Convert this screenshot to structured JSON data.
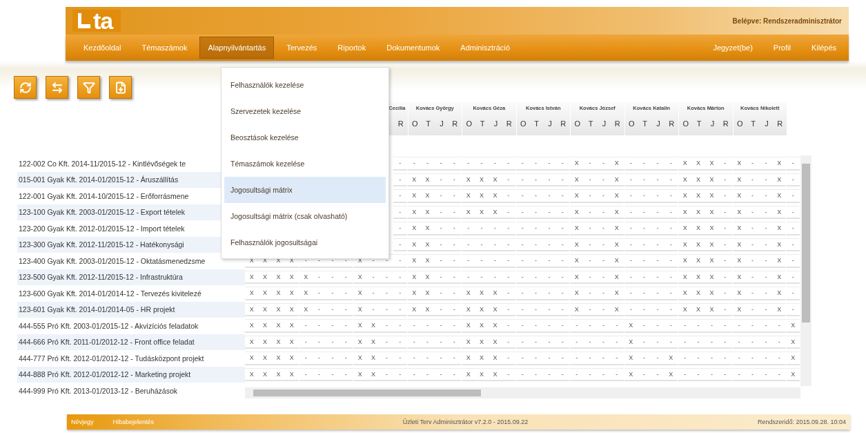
{
  "header": {
    "logo": "ta",
    "login": "Belépve: Rendszeradminisztrátor"
  },
  "nav": {
    "items": [
      {
        "label": "Kezdőoldal",
        "selected": false
      },
      {
        "label": "Témaszámok",
        "selected": false
      },
      {
        "label": "Alapnyilvántartás",
        "selected": true
      },
      {
        "label": "Tervezés",
        "selected": false
      },
      {
        "label": "Riportok",
        "selected": false
      },
      {
        "label": "Dokumentumok",
        "selected": false
      },
      {
        "label": "Adminisztráció",
        "selected": false
      }
    ],
    "right_items": [
      "Jegyzet(be)",
      "Profil",
      "Kilépés"
    ]
  },
  "toolbar": [
    {
      "kind": "refresh"
    },
    {
      "kind": "columns"
    },
    {
      "kind": "filter"
    },
    {
      "kind": "export"
    }
  ],
  "dropdown": [
    {
      "label": "Felhasználók kezelése",
      "selected": false
    },
    {
      "label": "Szervezetek kezelése",
      "selected": false
    },
    {
      "label": "Beosztások kezelése",
      "selected": false
    },
    {
      "label": "Témaszámok kezelése",
      "selected": false
    },
    {
      "label": "Jogosultsági mátrix",
      "selected": true
    },
    {
      "label": "Jogosultsági mátrix (csak olvasható)",
      "selected": false
    },
    {
      "label": "Felhasználók jogosultságai",
      "selected": false
    }
  ],
  "matrix": {
    "people": [
      {
        "name": "Cecília",
        "letters": [
          "R"
        ]
      },
      {
        "name": "Kovács György",
        "letters": [
          "O",
          "T",
          "J",
          "R"
        ]
      },
      {
        "name": "Kovács Géza",
        "letters": [
          "O",
          "T",
          "J",
          "R"
        ]
      },
      {
        "name": "Kovács István",
        "letters": [
          "O",
          "T",
          "J",
          "R"
        ]
      },
      {
        "name": "Kovács József",
        "letters": [
          "O",
          "T",
          "J",
          "R"
        ]
      },
      {
        "name": "Kovács Katalin",
        "letters": [
          "O",
          "T",
          "J",
          "R"
        ]
      },
      {
        "name": "Kovács Márton",
        "letters": [
          "O",
          "T",
          "J",
          "R"
        ]
      },
      {
        "name": "Kovács Nikolett",
        "letters": [
          "O",
          "T",
          "J",
          "R"
        ]
      }
    ],
    "rows": [
      {
        "label": "122-002 Co Kft. 2014-11/2015-12 - Kintlévőségek te",
        "cells": [
          "-",
          "-",
          "-",
          "-",
          "-",
          "-",
          "-",
          "-",
          "-",
          "-",
          "-",
          "-",
          "-",
          "X",
          "-",
          "-",
          "X",
          "-",
          "-",
          "-",
          "-",
          "X",
          "X",
          "X",
          "-",
          "X",
          "-",
          "-",
          "X",
          "-"
        ]
      },
      {
        "label": "015-001 Gyak Kft. 2014-01/2015-12 - Áruszállítás",
        "cells": [
          "-",
          "X",
          "X",
          "-",
          "-",
          "X",
          "X",
          "X",
          "-",
          "-",
          "-",
          "-",
          "-",
          "X",
          "-",
          "-",
          "X",
          "-",
          "-",
          "-",
          "-",
          "X",
          "X",
          "X",
          "-",
          "X",
          "-",
          "-",
          "X",
          "-"
        ]
      },
      {
        "label": "122-001 Gyak Kft. 2014-10/2015-12 - Erőforrásmene",
        "cells": [
          "-",
          "X",
          "X",
          "-",
          "-",
          "X",
          "X",
          "X",
          "-",
          "-",
          "-",
          "-",
          "-",
          "X",
          "-",
          "-",
          "X",
          "-",
          "-",
          "-",
          "-",
          "X",
          "X",
          "X",
          "-",
          "X",
          "-",
          "-",
          "X",
          "-"
        ]
      },
      {
        "label": "123-100 Gyak Kft. 2003-01/2015-12 - Export tételek",
        "cells": [
          "-",
          "X",
          "X",
          "-",
          "-",
          "X",
          "X",
          "X",
          "-",
          "-",
          "-",
          "-",
          "-",
          "X",
          "-",
          "-",
          "X",
          "-",
          "-",
          "-",
          "-",
          "X",
          "X",
          "X",
          "-",
          "X",
          "-",
          "-",
          "X",
          "-"
        ]
      },
      {
        "label": "123-200 Gyak Kft. 2012-01/2015-12 - Import tételek",
        "cells": [
          "-",
          "X",
          "X",
          "-",
          "-",
          "-",
          "-",
          "-",
          "-",
          "-",
          "-",
          "-",
          "-",
          "X",
          "-",
          "-",
          "X",
          "-",
          "-",
          "-",
          "-",
          "X",
          "X",
          "X",
          "-",
          "X",
          "-",
          "-",
          "X",
          "-"
        ]
      },
      {
        "label": "123-300 Gyak Kft. 2012-11/2015-12 - Hatékonysági",
        "cells": [
          "-",
          "X",
          "X",
          "-",
          "-",
          "-",
          "-",
          "-",
          "-",
          "-",
          "-",
          "-",
          "-",
          "X",
          "-",
          "-",
          "X",
          "-",
          "-",
          "-",
          "-",
          "X",
          "X",
          "X",
          "-",
          "X",
          "-",
          "-",
          "X",
          "-"
        ]
      },
      {
        "label": "123-400 Gyak Kft. 2003-01/2015-12 - Oktatásmenedzsme",
        "cells": [
          "X",
          "X",
          "X",
          "X",
          "-",
          "-",
          "-",
          "-",
          "X",
          "-",
          "-",
          "-",
          "X",
          "X",
          "-",
          "-",
          "-",
          "-",
          "-",
          "-",
          "-",
          "-",
          "-",
          "-",
          "X",
          "-",
          "-",
          "X",
          "-",
          "-",
          "-",
          "-",
          "X",
          "X",
          "X",
          "-",
          "X",
          "-",
          "-",
          "X",
          "-"
        ]
      },
      {
        "label": "123-500 Gyak Kft. 2012-11/2015-12 - Infrastruktúra",
        "cells": [
          "X",
          "X",
          "X",
          "X",
          "X",
          "-",
          "-",
          "-",
          "X",
          "-",
          "-",
          "-",
          "X",
          "X",
          "-",
          "-",
          "-",
          "-",
          "-",
          "-",
          "-",
          "-",
          "-",
          "-",
          "X",
          "-",
          "-",
          "X",
          "-",
          "-",
          "-",
          "-",
          "X",
          "X",
          "X",
          "-",
          "X",
          "-",
          "-",
          "X",
          "-"
        ]
      },
      {
        "label": "123-600 Gyak Kft. 2014-01/2014-12 - Tervezés kivitelezé",
        "cells": [
          "X",
          "X",
          "X",
          "X",
          "X",
          "-",
          "-",
          "-",
          "X",
          "-",
          "-",
          "-",
          "X",
          "X",
          "-",
          "-",
          "X",
          "X",
          "X",
          "-",
          "-",
          "-",
          "-",
          "-",
          "X",
          "-",
          "-",
          "X",
          "-",
          "-",
          "-",
          "-",
          "X",
          "X",
          "X",
          "-",
          "X",
          "-",
          "-",
          "X",
          "-"
        ]
      },
      {
        "label": "123-601 Gyak Kft. 2014-01/2014-05 - HR projekt",
        "cells": [
          "X",
          "X",
          "X",
          "X",
          "X",
          "-",
          "-",
          "-",
          "X",
          "-",
          "-",
          "-",
          "X",
          "X",
          "-",
          "-",
          "X",
          "X",
          "X",
          "-",
          "-",
          "-",
          "-",
          "-",
          "X",
          "-",
          "-",
          "X",
          "-",
          "-",
          "-",
          "-",
          "X",
          "X",
          "X",
          "-",
          "X",
          "-",
          "-",
          "X",
          "-"
        ]
      },
      {
        "label": "444-555 Pró Kft. 2003-01/2015-12 - Akvizíciós feladatok",
        "cells": [
          "X",
          "X",
          "X",
          "X",
          "-",
          "-",
          "-",
          "-",
          "X",
          "X",
          "-",
          "-",
          "-",
          "-",
          "-",
          "-",
          "X",
          "X",
          "X",
          "-",
          "-",
          "-",
          "-",
          "-",
          "-",
          "-",
          "-",
          "-",
          "X",
          "-",
          "-",
          "-",
          "-",
          "-",
          "-",
          "-",
          "-",
          "-",
          "-",
          "-",
          "X"
        ]
      },
      {
        "label": "444-666 Pró Kft. 2011-01/2012-12 - Front office feladat",
        "cells": [
          "X",
          "X",
          "X",
          "X",
          "-",
          "-",
          "-",
          "-",
          "X",
          "X",
          "-",
          "-",
          "-",
          "-",
          "-",
          "-",
          "X",
          "X",
          "X",
          "-",
          "-",
          "-",
          "-",
          "-",
          "-",
          "-",
          "-",
          "-",
          "X",
          "-",
          "-",
          "-",
          "-",
          "-",
          "-",
          "-",
          "-",
          "-",
          "-",
          "-",
          "X"
        ]
      },
      {
        "label": "444-777 Pró Kft. 2012-01/2012-12 - Tudásközpont projekt",
        "cells": [
          "X",
          "X",
          "X",
          "X",
          "-",
          "-",
          "-",
          "-",
          "X",
          "X",
          "-",
          "-",
          "-",
          "-",
          "-",
          "-",
          "X",
          "X",
          "X",
          "-",
          "-",
          "-",
          "-",
          "-",
          "-",
          "-",
          "-",
          "-",
          "X",
          "-",
          "-",
          "X",
          "-",
          "-",
          "-",
          "-",
          "-",
          "-",
          "-",
          "-",
          "X"
        ]
      },
      {
        "label": "444-888 Pró Kft. 2012-01/2012-12 - Marketing projekt",
        "cells": [
          "X",
          "X",
          "X",
          "X",
          "-",
          "-",
          "-",
          "-",
          "X",
          "X",
          "-",
          "-",
          "-",
          "-",
          "-",
          "-",
          "X",
          "X",
          "X",
          "-",
          "-",
          "-",
          "-",
          "-",
          "-",
          "-",
          "-",
          "-",
          "X",
          "-",
          "-",
          "X",
          "-",
          "-",
          "-",
          "-",
          "-",
          "-",
          "-",
          "-",
          "X"
        ]
      },
      {
        "label": "444-999 Pró Kft. 2013-01/2013-12 - Beruházások"
      }
    ]
  },
  "footer": {
    "left": [
      "Névjegy",
      "Hibabejelentés"
    ],
    "center": "Üzleti Terv Adminisztrátor v7.2.0 - 2015.09.22",
    "right": "Rendszeridő:  2015.09.28. 10:04"
  }
}
